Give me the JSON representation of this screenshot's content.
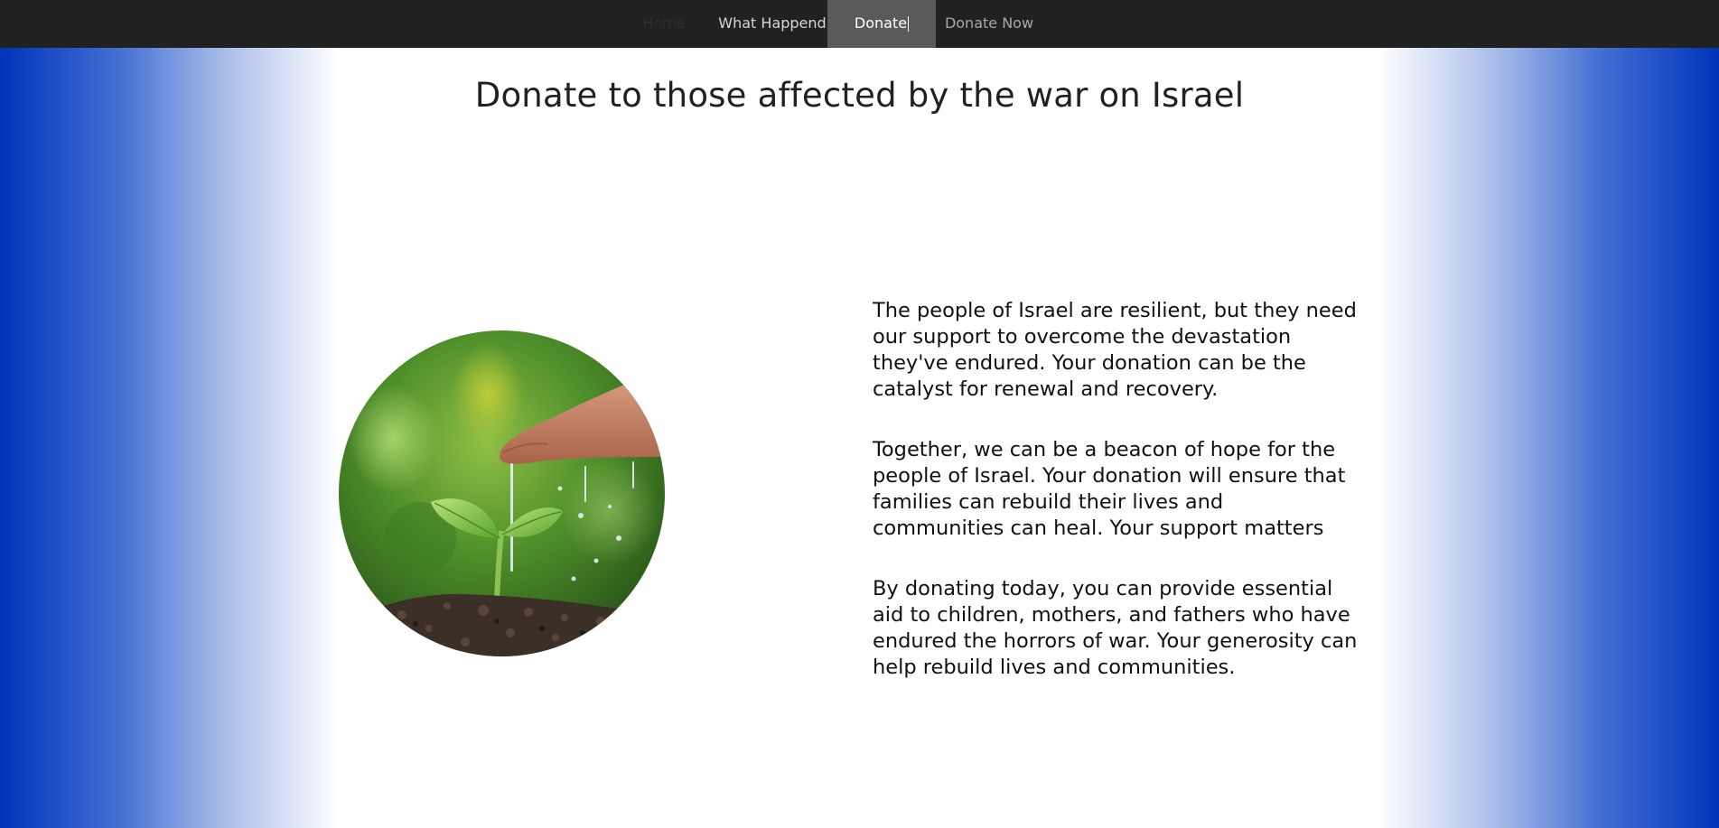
{
  "nav": {
    "items": [
      {
        "label": "Home"
      },
      {
        "label": "What Happend"
      },
      {
        "label": "Donate"
      },
      {
        "label": "Donate Now"
      }
    ]
  },
  "page": {
    "title": "Donate to those affected by the war on Israel"
  },
  "image": {
    "subject": "hand watering a seedling in soil"
  },
  "content": {
    "paragraphs": [
      "The people of Israel are resilient, but they need our support to overcome the devastation they've endured. Your donation can be the catalyst for renewal and recovery.",
      "Together, we can be a beacon of hope for the people of Israel. Your donation will ensure that families can rebuild their lives and communities can heal. Your support matters",
      "By donating today, you can provide essential aid to children, mothers, and fathers who have endured the horrors of war. Your generosity can help rebuild lives and communities."
    ]
  },
  "colors": {
    "navbar": "#212121",
    "nav_active": "#5a5a5a",
    "side_gradient": "#0033bb"
  }
}
